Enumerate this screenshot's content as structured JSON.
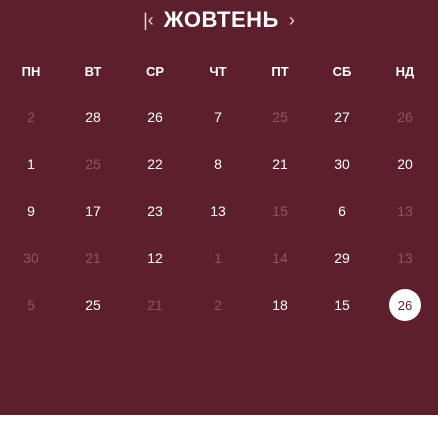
{
  "header": {
    "prev": "|‹",
    "month": "ЖОВТЕНЬ",
    "next": "›"
  },
  "weekdays": [
    "ПН",
    "ВТ",
    "СР",
    "ЧТ",
    "ПТ",
    "СБ",
    "НД"
  ],
  "weeks": [
    [
      {
        "label": "2",
        "dim": true
      },
      {
        "label": "28",
        "dim": false
      },
      {
        "label": "26",
        "dim": false
      },
      {
        "label": "7",
        "dim": false
      },
      {
        "label": "25",
        "dim": true
      },
      {
        "label": "27",
        "dim": false
      },
      {
        "label": "26",
        "dim": true
      }
    ],
    [
      {
        "label": "1",
        "dim": false
      },
      {
        "label": "25",
        "dim": true
      },
      {
        "label": "22",
        "dim": false
      },
      {
        "label": "8",
        "dim": false
      },
      {
        "label": "21",
        "dim": false
      },
      {
        "label": "30",
        "dim": false
      },
      {
        "label": "20",
        "dim": false
      }
    ],
    [
      {
        "label": "9",
        "dim": false
      },
      {
        "label": "17",
        "dim": false
      },
      {
        "label": "23",
        "dim": false
      },
      {
        "label": "13",
        "dim": false
      },
      {
        "label": "15",
        "dim": true
      },
      {
        "label": "6",
        "dim": false
      },
      {
        "label": "13",
        "dim": true
      }
    ],
    [
      {
        "label": "30",
        "dim": true
      },
      {
        "label": "21",
        "dim": true
      },
      {
        "label": "12",
        "dim": false
      },
      {
        "label": "1",
        "dim": true
      },
      {
        "label": "14",
        "dim": true
      },
      {
        "label": "29",
        "dim": false
      },
      {
        "label": "13",
        "dim": true
      }
    ],
    [
      {
        "label": "5",
        "dim": true
      },
      {
        "label": "25",
        "dim": false
      },
      {
        "label": "21",
        "dim": true
      },
      {
        "label": "2",
        "dim": true
      },
      {
        "label": "18",
        "dim": false
      },
      {
        "label": "15",
        "dim": false
      },
      {
        "label": "26",
        "dim": false,
        "selected": true
      }
    ]
  ],
  "colors": {
    "background": "#5e1f2c",
    "text": "#ffffff",
    "dim_text": "#8e5663",
    "selected_bg": "#ffffff"
  }
}
